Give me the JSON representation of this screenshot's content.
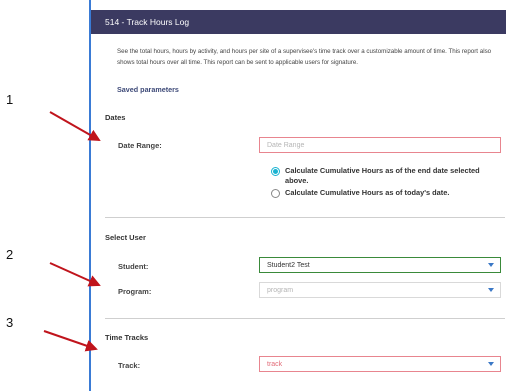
{
  "header": {
    "title": "514 - Track Hours Log"
  },
  "description": "See the total hours, hours by activity, and hours per site of a supervisee's time track over a customizable amount of time. This report also shows total hours over all time. This report can be sent to applicable users for signature.",
  "saved_parameters": "Saved parameters",
  "dates": {
    "section_title": "Dates",
    "date_range_label": "Date Range:",
    "date_range_placeholder": "Date Range",
    "options": [
      "Calculate Cumulative Hours as of the end date selected above.",
      "Calculate Cumulative Hours as of today's date."
    ],
    "selected_option": 0
  },
  "select_user": {
    "section_title": "Select User",
    "student_label": "Student:",
    "student_value": "Student2 Test",
    "program_label": "Program:",
    "program_placeholder": "program"
  },
  "time_tracks": {
    "section_title": "Time Tracks",
    "track_label": "Track:",
    "track_value": "track"
  },
  "annotations": [
    "1",
    "2",
    "3"
  ],
  "colors": {
    "header_bg": "#3b3a61",
    "accent_blue": "#3a7bd5",
    "error_red": "#e8858f",
    "valid_green": "#3a8a3a",
    "arrow": "#c0141c"
  }
}
